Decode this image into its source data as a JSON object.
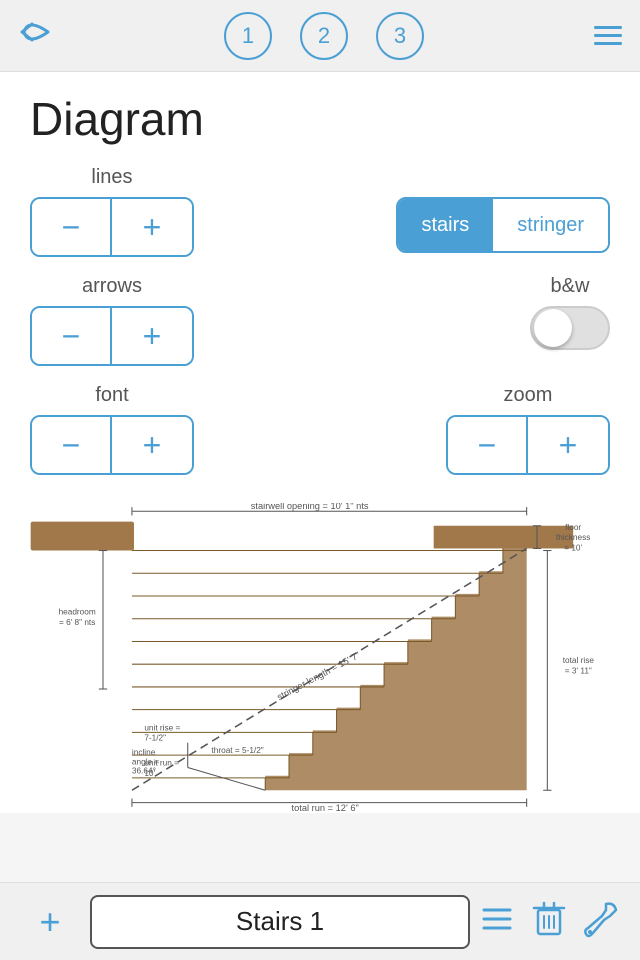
{
  "nav": {
    "back_arrow": "←",
    "step1": "1",
    "step2": "2",
    "step3": "3"
  },
  "page": {
    "title": "Diagram"
  },
  "controls": {
    "lines_label": "lines",
    "arrows_label": "arrows",
    "font_label": "font",
    "bw_label": "b&w",
    "zoom_label": "zoom",
    "minus": "−",
    "plus": "+"
  },
  "segmented": {
    "stairs_label": "stairs",
    "stringer_label": "stringer"
  },
  "diagram": {
    "label_stairwell": "stairwell opening = 10' 1\" nts",
    "label_floor_thickness": "floor thickness = 10'",
    "label_headroom": "headroom = 6' 8\" nts",
    "label_stringer": "stringer length = 15' 7\"",
    "label_total_rise": "total rise = 3' 11\"",
    "label_unit_run": "unit run = 10'",
    "label_unit_rise": "unit rise = 7-1/2\"",
    "label_incline": "incline angle = 36.64°",
    "label_throat": "throat = 5-1/2\"",
    "label_total_run": "total run = 12' 6\""
  },
  "bottom": {
    "add_icon": "+",
    "title": "Stairs 1"
  }
}
